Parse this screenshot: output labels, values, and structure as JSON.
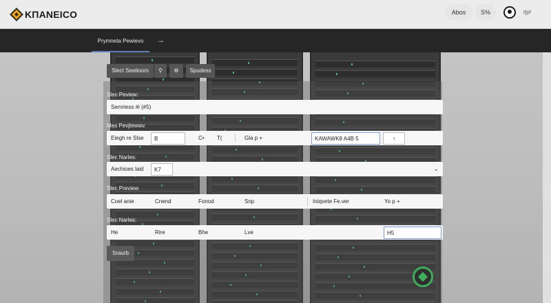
{
  "header": {
    "brand": "KΠANEICO",
    "about": "Abos",
    "s_button": "S%",
    "user": "rjyr"
  },
  "nav": {
    "tab": "Prymneta Pewievo",
    "arrow": "→"
  },
  "toolbar": {
    "select_label": "Slect Seatioors",
    "search_icon": "⚲",
    "gear_icon": "⚙",
    "spudess": "Spudess"
  },
  "sections": {
    "s1": "Slec Peview:",
    "s2": "Mes Pevitewwv.",
    "s3": "Slec Narles:",
    "s4": "Slec Preview",
    "s5": "Slec Narles:"
  },
  "row1": {
    "text": "Semriess #i (#5)"
  },
  "row2": {
    "label": "Eiegh re Slse",
    "input_b": "B",
    "c_text": "C•",
    "t_text": "T(",
    "gla": "Gla p +",
    "field": "KAWAWK8 A4B 5",
    "up": "↑"
  },
  "row3": {
    "label": "Aechioes laid",
    "input": "K7",
    "chev": "⌄"
  },
  "row4": {
    "c1": "Coel anie",
    "c2": "Cnend",
    "c3": "Fonod",
    "c4": "Snp",
    "c5": "Iniqvete Fe.ver",
    "c6": "Yo p +"
  },
  "row5": {
    "c1": "He",
    "c2": "Rire",
    "c3": "Bhe",
    "c4": "Lve",
    "field": "H5"
  },
  "search_button": "Sraurb",
  "colors": {
    "accent": "#f0a21a",
    "nav_bg": "#262626",
    "fab_green": "#3fae5a"
  }
}
